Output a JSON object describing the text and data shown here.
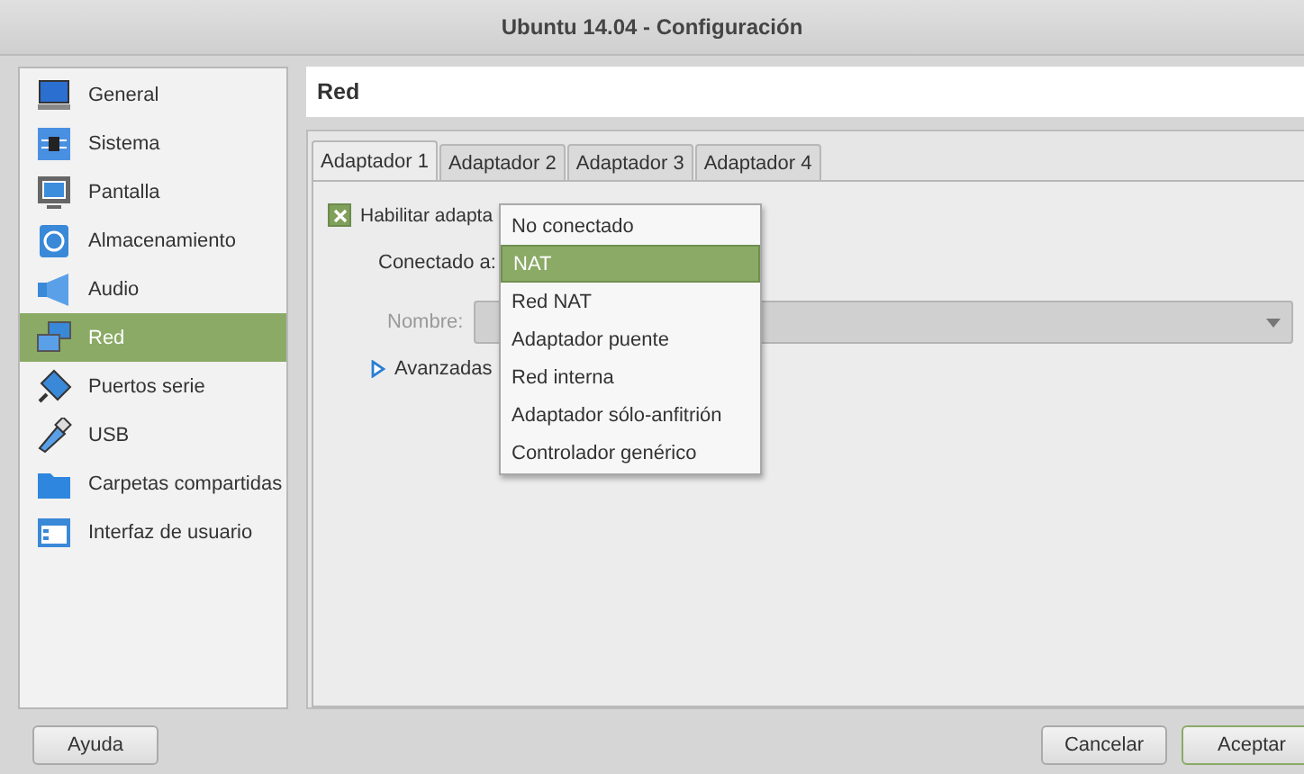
{
  "window": {
    "title": "Ubuntu 14.04 - Configuración"
  },
  "sidebar": {
    "items": [
      {
        "label": "General",
        "selected": false
      },
      {
        "label": "Sistema",
        "selected": false
      },
      {
        "label": "Pantalla",
        "selected": false
      },
      {
        "label": "Almacenamiento",
        "selected": false
      },
      {
        "label": "Audio",
        "selected": false
      },
      {
        "label": "Red",
        "selected": true
      },
      {
        "label": "Puertos serie",
        "selected": false
      },
      {
        "label": "USB",
        "selected": false
      },
      {
        "label": "Carpetas compartidas",
        "selected": false
      },
      {
        "label": "Interfaz de usuario",
        "selected": false
      }
    ]
  },
  "page": {
    "title": "Red",
    "tabs": [
      {
        "label": "Adaptador 1",
        "selected": true
      },
      {
        "label": "Adaptador 2",
        "selected": false
      },
      {
        "label": "Adaptador 3",
        "selected": false
      },
      {
        "label": "Adaptador 4",
        "selected": false
      }
    ],
    "enable_checkbox": {
      "label": "Habilitar adapta",
      "checked": true
    },
    "connected_label": "Conectado a:",
    "name_field": {
      "label": "Nombre:",
      "disabled": true
    },
    "advanced": {
      "label": "Avanzadas",
      "expanded": false
    },
    "dropdown_menu": [
      {
        "label": "No conectado",
        "selected": false
      },
      {
        "label": "NAT",
        "selected": true
      },
      {
        "label": "Red NAT",
        "selected": false
      },
      {
        "label": "Adaptador puente",
        "selected": false
      },
      {
        "label": "Red interna",
        "selected": false
      },
      {
        "label": "Adaptador sólo-anfitrión",
        "selected": false
      },
      {
        "label": "Controlador genérico",
        "selected": false
      }
    ]
  },
  "buttons": {
    "help": "Ayuda",
    "cancel": "Cancelar",
    "ok": "Aceptar"
  }
}
